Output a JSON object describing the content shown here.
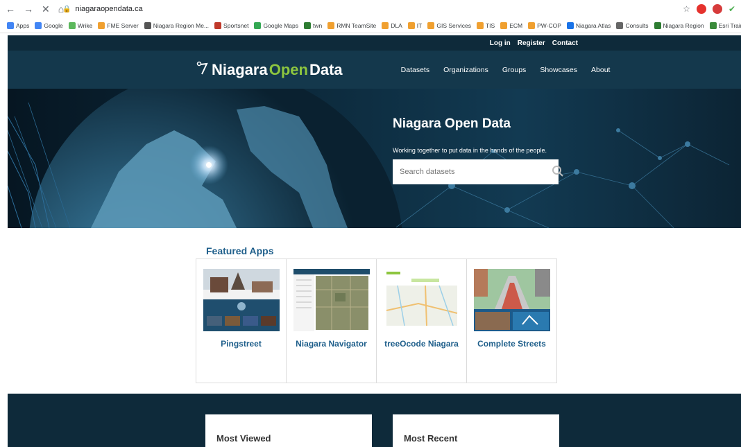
{
  "browser": {
    "url": "niagaraopendata.ca",
    "bookmarks": [
      "Apps",
      "Google",
      "Wrike",
      "FME Server",
      "Niagara Region Me...",
      "Sportsnet",
      "Google Maps",
      "twn",
      "RMN TeamSite",
      "DLA",
      "IT",
      "GIS Services",
      "TIS",
      "ECM",
      "PW-COP",
      "Niagara Atlas",
      "Consults",
      "Niagara Region",
      "Esri Training Catalo..."
    ],
    "bookmark_colors": [
      "#4285f4",
      "#4285f4",
      "#5cb85c",
      "#f0a030",
      "#555555",
      "#c0392b",
      "#34a853",
      "#2e7d32",
      "#f0a030",
      "#f0a030",
      "#f0a030",
      "#f0a030",
      "#f0a030",
      "#f0a030",
      "#f0a030",
      "#1a73e8",
      "#666666",
      "#2e7d32",
      "#3a8a3a"
    ]
  },
  "site": {
    "util_links": [
      "Log in",
      "Register",
      "Contact"
    ],
    "logo_prefix": "Niagara",
    "logo_open": "Open",
    "logo_suffix": "Data",
    "nav": [
      "Datasets",
      "Organizations",
      "Groups",
      "Showcases",
      "About"
    ],
    "hero_title": "Niagara Open Data",
    "hero_subtitle": "Working together to put data in the hands of the people.",
    "search_placeholder": "Search datasets",
    "featured_title": "Featured Apps",
    "apps": [
      "Pingstreet",
      "Niagara Navigator",
      "treeOcode Niagara",
      "Complete Streets"
    ],
    "most_viewed": "Most Viewed",
    "most_recent": "Most Recent"
  },
  "colors": {
    "accent_green": "#8dc63f",
    "header_dark": "#14384c",
    "link_blue": "#1f5f8b"
  }
}
